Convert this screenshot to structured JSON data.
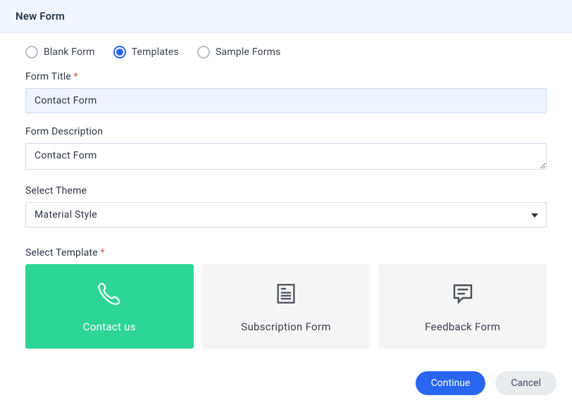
{
  "header": {
    "title": "New Form"
  },
  "radios": {
    "selected": 1,
    "options": [
      {
        "label": "Blank Form"
      },
      {
        "label": "Templates"
      },
      {
        "label": "Sample Forms"
      }
    ]
  },
  "form_title": {
    "label": "Form Title",
    "value": "Contact Form"
  },
  "form_description": {
    "label": "Form Description",
    "value": "Contact Form"
  },
  "theme": {
    "label": "Select Theme",
    "value": "Material Style"
  },
  "template": {
    "label": "Select Template",
    "selected": 0,
    "options": [
      {
        "name": "Contact us",
        "icon": "phone-icon"
      },
      {
        "name": "Subscription Form",
        "icon": "newspaper-icon"
      },
      {
        "name": "Feedback Form",
        "icon": "speech-bubble-icon"
      }
    ]
  },
  "buttons": {
    "continue": "Continue",
    "cancel": "Cancel"
  }
}
